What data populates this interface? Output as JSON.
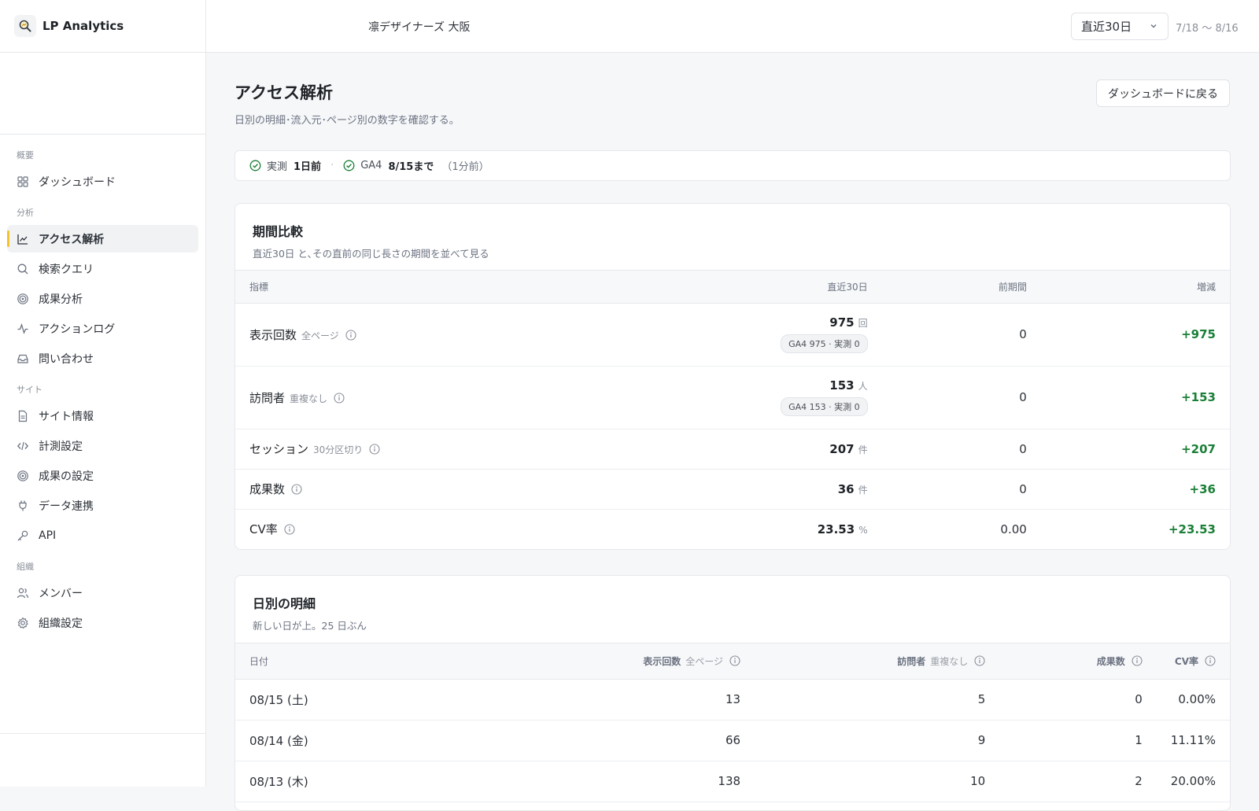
{
  "app": {
    "name": "LP Analytics"
  },
  "sidebar": {
    "sections": [
      {
        "label": "概要",
        "items": [
          {
            "label": "ダッシュボード",
            "icon": "grid-icon"
          }
        ]
      },
      {
        "label": "分析",
        "items": [
          {
            "label": "アクセス解析",
            "icon": "line-chart-icon",
            "active": true
          },
          {
            "label": "検索クエリ",
            "icon": "search-icon"
          },
          {
            "label": "成果分析",
            "icon": "target-icon"
          },
          {
            "label": "アクションログ",
            "icon": "activity-icon"
          },
          {
            "label": "問い合わせ",
            "icon": "inbox-icon"
          }
        ]
      },
      {
        "label": "サイト",
        "items": [
          {
            "label": "サイト情報",
            "icon": "document-icon"
          },
          {
            "label": "計測設定",
            "icon": "code-icon"
          },
          {
            "label": "成果の設定",
            "icon": "target-icon"
          },
          {
            "label": "データ連携",
            "icon": "plug-icon"
          },
          {
            "label": "API",
            "icon": "key-icon"
          }
        ]
      },
      {
        "label": "組織",
        "items": [
          {
            "label": "メンバー",
            "icon": "users-icon"
          },
          {
            "label": "組織設定",
            "icon": "gear-icon"
          }
        ]
      }
    ]
  },
  "topbar": {
    "org_name": "凛デザイナーズ 大阪",
    "range_value": "直近30日",
    "range_dates": "7/18 〜 8/16"
  },
  "page": {
    "title": "アクセス解析",
    "subtitle": "日別の明細･流入元･ページ別の数字を確認する。",
    "back_label": "ダッシュボードに戻る"
  },
  "status": {
    "measured_label": "実測",
    "measured_value": "1日前",
    "sep": "·",
    "ga4_label": "GA4",
    "ga4_value": "8/15まで",
    "ga4_note": "（1分前）"
  },
  "comparison": {
    "title": "期間比較",
    "subtitle": "直近30日 と､その直前の同じ長さの期間を並べて見る",
    "headers": {
      "metric": "指標",
      "current": "直近30日",
      "previous": "前期間",
      "delta": "増減"
    },
    "rows": [
      {
        "name": "表示回数",
        "note": "全ページ",
        "value": "975",
        "unit": "回",
        "source": "GA4 975 · 実測 0",
        "previous": "0",
        "delta": "+975"
      },
      {
        "name": "訪問者",
        "note": "重複なし",
        "value": "153",
        "unit": "人",
        "source": "GA4 153 · 実測 0",
        "previous": "0",
        "delta": "+153"
      },
      {
        "name": "セッション",
        "note": "30分区切り",
        "value": "207",
        "unit": "件",
        "source": "",
        "previous": "0",
        "delta": "+207"
      },
      {
        "name": "成果数",
        "note": "",
        "value": "36",
        "unit": "件",
        "source": "",
        "previous": "0",
        "delta": "+36"
      },
      {
        "name": "CV率",
        "note": "",
        "value": "23.53",
        "unit": "%",
        "source": "",
        "previous": "0.00",
        "delta": "+23.53"
      }
    ]
  },
  "daily": {
    "title": "日別の明細",
    "subtitle": "新しい日が上。25 日ぶん",
    "headers": {
      "date": "日付",
      "views": "表示回数",
      "views_note": "全ページ",
      "visitors": "訪問者",
      "visitors_note": "重複なし",
      "conversions": "成果数",
      "cvr": "CV率"
    },
    "rows": [
      {
        "date": "08/15 (土)",
        "views": "13",
        "visitors": "5",
        "conversions": "0",
        "cvr": "0.00%"
      },
      {
        "date": "08/14 (金)",
        "views": "66",
        "visitors": "9",
        "conversions": "1",
        "cvr": "11.11%"
      },
      {
        "date": "08/13 (木)",
        "views": "138",
        "visitors": "10",
        "conversions": "2",
        "cvr": "20.00%"
      }
    ]
  },
  "colors": {
    "accent": "#f2c230",
    "positive": "#1a7f37"
  }
}
